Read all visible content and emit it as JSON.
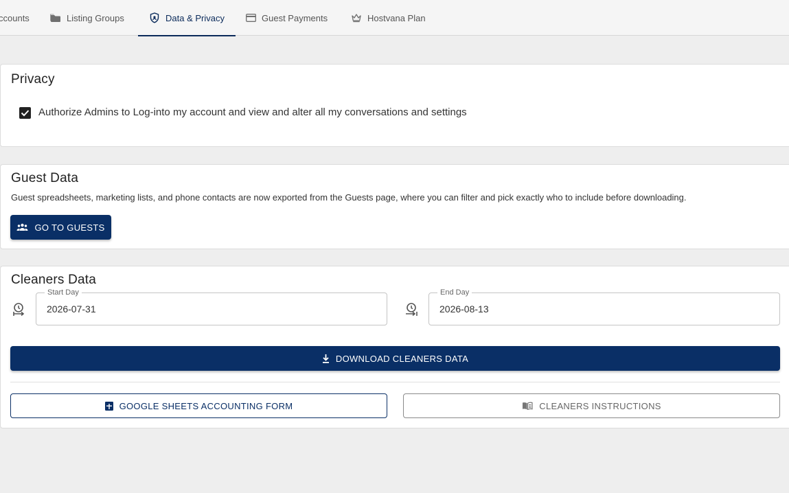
{
  "tabs": [
    {
      "label": "ccounts",
      "icon": "accounts-icon"
    },
    {
      "label": "Listing Groups",
      "icon": "folder-icon"
    },
    {
      "label": "Data & Privacy",
      "icon": "shield-icon"
    },
    {
      "label": "Guest Payments",
      "icon": "credit-card-icon"
    },
    {
      "label": "Hostvana Plan",
      "icon": "crown-icon"
    }
  ],
  "active_tab": "Data & Privacy",
  "privacy": {
    "title": "Privacy",
    "checkbox_label": "Authorize Admins to Log-into my account and view and alter all my conversations and settings",
    "checked": true
  },
  "guest_data": {
    "title": "Guest Data",
    "description": "Guest spreadsheets, marketing lists, and phone contacts are now exported from the Guests page, where you can filter and pick exactly who to include before downloading.",
    "button_label": "GO TO GUESTS"
  },
  "cleaners_data": {
    "title": "Cleaners Data",
    "start_label": "Start Day",
    "start_value": "2026-07-31",
    "end_label": "End Day",
    "end_value": "2026-08-13",
    "download_label": "DOWNLOAD CLEANERS DATA",
    "sheets_label": "GOOGLE SHEETS ACCOUNTING FORM",
    "instructions_label": "CLEANERS INSTRUCTIONS"
  },
  "colors": {
    "primary": "#0a2f66",
    "background": "#eeeeee",
    "card": "#ffffff"
  }
}
